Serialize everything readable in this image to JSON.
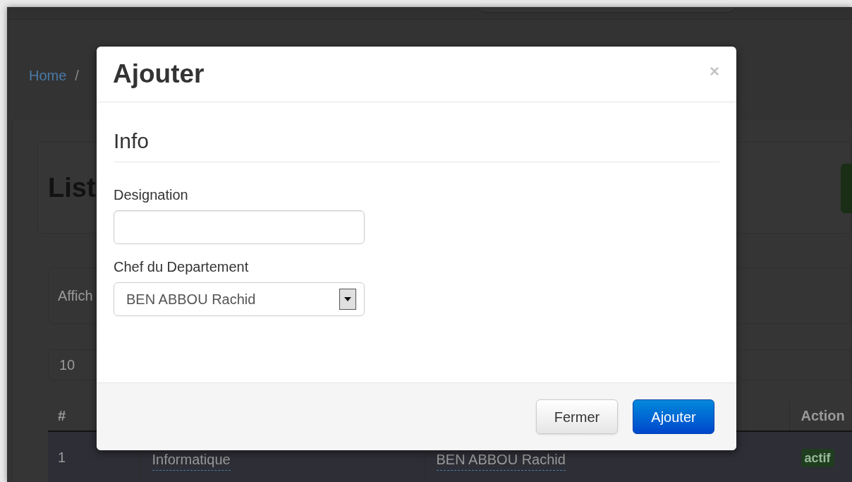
{
  "breadcrumb": [
    "Home",
    "/"
  ],
  "page": {
    "heading": "List",
    "filter_text": "Affich",
    "page_size": "10",
    "table": {
      "columns": [
        "#",
        "Action"
      ],
      "rows": [
        {
          "cells": [
            "1",
            "Informatique",
            "BEN ABBOU Rachid"
          ],
          "status": "actif"
        }
      ]
    }
  },
  "modal": {
    "title": "Ajouter",
    "close": "×",
    "section": "Info",
    "fields": [
      {
        "kind": "text",
        "label": "Designation"
      },
      {
        "kind": "select",
        "label": "Chef du Departement",
        "value": "BEN ABBOU Rachid"
      }
    ],
    "buttons": [
      {
        "kind": "default",
        "label": "Fermer"
      },
      {
        "kind": "primary",
        "label": "Ajouter"
      }
    ]
  }
}
